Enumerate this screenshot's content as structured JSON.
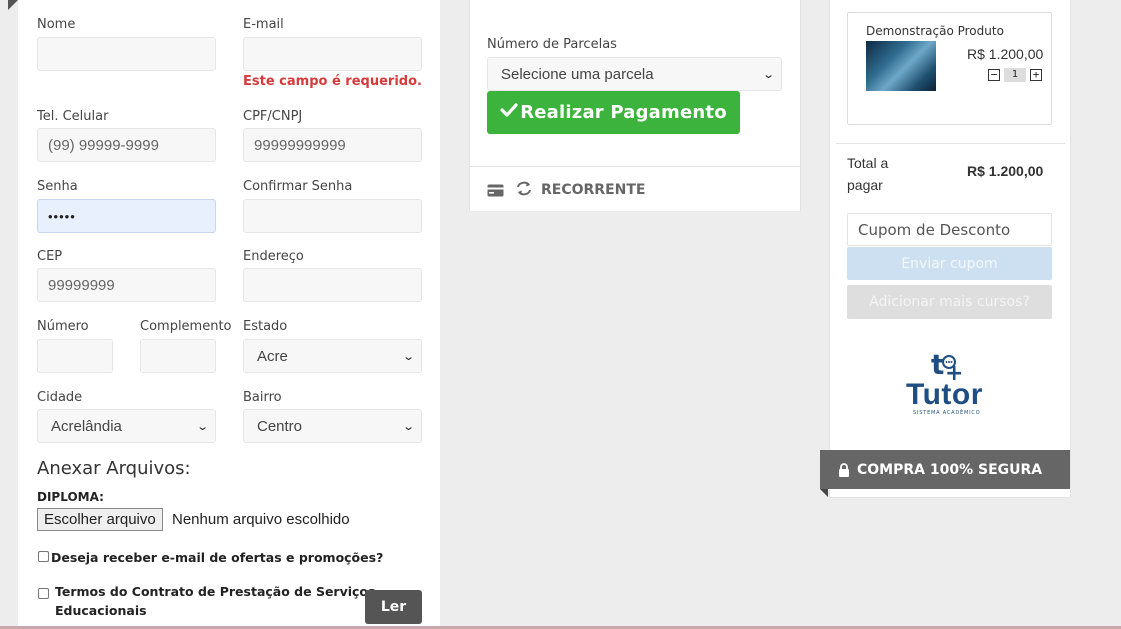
{
  "form": {
    "nome_label": "Nome",
    "email_label": "E-mail",
    "email_error": "Este campo é requerido.",
    "celular_label": "Tel. Celular",
    "celular_placeholder": "(99) 99999-9999",
    "cpf_label": "CPF/CNPJ",
    "cpf_placeholder": "99999999999",
    "senha_label": "Senha",
    "senha_value": "•••••",
    "confirmar_label": "Confirmar Senha",
    "cep_label": "CEP",
    "cep_placeholder": "99999999",
    "endereco_label": "Endereço",
    "numero_label": "Número",
    "complemento_label": "Complemento",
    "estado_label": "Estado",
    "estado_value": "Acre",
    "cidade_label": "Cidade",
    "cidade_value": "Acrelândia",
    "bairro_label": "Bairro",
    "bairro_value": "Centro",
    "anexar_title": "Anexar Arquivos:",
    "diploma_label": "DIPLOMA:",
    "file_button": "Escolher arquivo",
    "file_none": "Nenhum arquivo escolhido",
    "ofertas_label": "Deseja receber e-mail de ofertas e promoções?",
    "termos_line1": "Termos do Contrato de Prestação de Serviços",
    "termos_line2": "Educacionais",
    "ler_button": "Ler"
  },
  "payment": {
    "parcelas_label": "Número de Parcelas",
    "parcelas_value": "Selecione uma parcela",
    "pay_button": "Realizar Pagamento",
    "recorrente_label": "RECORRENTE"
  },
  "cart": {
    "product_name": "Demonstração Produto",
    "product_price": "R$ 1.200,00",
    "quantity": "1",
    "total_label_line1": "Total a",
    "total_label_line2": "pagar",
    "total_value": "R$ 1.200,00",
    "coupon_placeholder": "Cupom de Desconto",
    "send_coupon": "Enviar cupom",
    "add_courses": "Adicionar mais cursos?",
    "logo_text": "Tutor",
    "logo_subtitle": "SISTEMA ACADÊMICO",
    "secure_label": "COMPRA 100% SEGURA"
  },
  "colors": {
    "pay_green": "#3cb33c",
    "error_red": "#d53b3b",
    "logo_blue": "#1f4f82"
  }
}
